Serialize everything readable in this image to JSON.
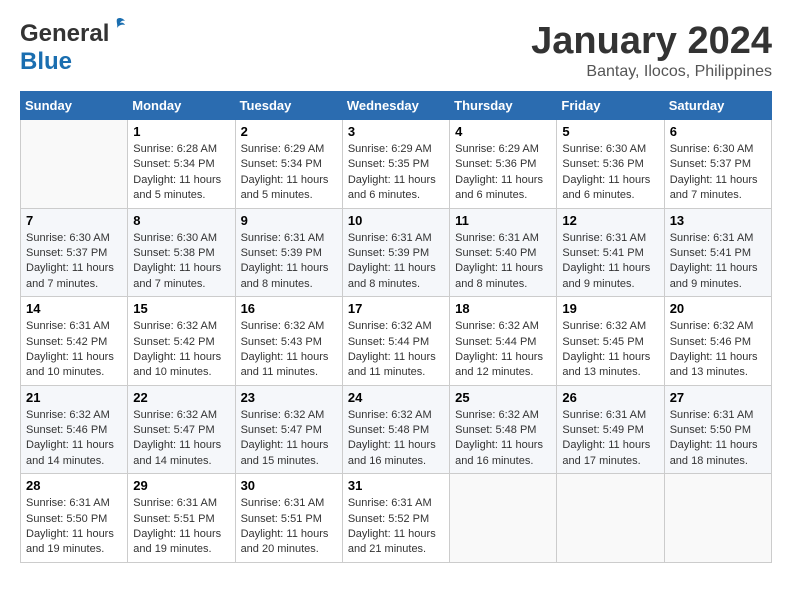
{
  "header": {
    "logo_line1": "General",
    "logo_line2": "Blue",
    "month": "January 2024",
    "location": "Bantay, Ilocos, Philippines"
  },
  "weekdays": [
    "Sunday",
    "Monday",
    "Tuesday",
    "Wednesday",
    "Thursday",
    "Friday",
    "Saturday"
  ],
  "weeks": [
    [
      {
        "day": "",
        "details": ""
      },
      {
        "day": "1",
        "details": "Sunrise: 6:28 AM\nSunset: 5:34 PM\nDaylight: 11 hours\nand 5 minutes."
      },
      {
        "day": "2",
        "details": "Sunrise: 6:29 AM\nSunset: 5:34 PM\nDaylight: 11 hours\nand 5 minutes."
      },
      {
        "day": "3",
        "details": "Sunrise: 6:29 AM\nSunset: 5:35 PM\nDaylight: 11 hours\nand 6 minutes."
      },
      {
        "day": "4",
        "details": "Sunrise: 6:29 AM\nSunset: 5:36 PM\nDaylight: 11 hours\nand 6 minutes."
      },
      {
        "day": "5",
        "details": "Sunrise: 6:30 AM\nSunset: 5:36 PM\nDaylight: 11 hours\nand 6 minutes."
      },
      {
        "day": "6",
        "details": "Sunrise: 6:30 AM\nSunset: 5:37 PM\nDaylight: 11 hours\nand 7 minutes."
      }
    ],
    [
      {
        "day": "7",
        "details": "Sunrise: 6:30 AM\nSunset: 5:37 PM\nDaylight: 11 hours\nand 7 minutes."
      },
      {
        "day": "8",
        "details": "Sunrise: 6:30 AM\nSunset: 5:38 PM\nDaylight: 11 hours\nand 7 minutes."
      },
      {
        "day": "9",
        "details": "Sunrise: 6:31 AM\nSunset: 5:39 PM\nDaylight: 11 hours\nand 8 minutes."
      },
      {
        "day": "10",
        "details": "Sunrise: 6:31 AM\nSunset: 5:39 PM\nDaylight: 11 hours\nand 8 minutes."
      },
      {
        "day": "11",
        "details": "Sunrise: 6:31 AM\nSunset: 5:40 PM\nDaylight: 11 hours\nand 8 minutes."
      },
      {
        "day": "12",
        "details": "Sunrise: 6:31 AM\nSunset: 5:41 PM\nDaylight: 11 hours\nand 9 minutes."
      },
      {
        "day": "13",
        "details": "Sunrise: 6:31 AM\nSunset: 5:41 PM\nDaylight: 11 hours\nand 9 minutes."
      }
    ],
    [
      {
        "day": "14",
        "details": "Sunrise: 6:31 AM\nSunset: 5:42 PM\nDaylight: 11 hours\nand 10 minutes."
      },
      {
        "day": "15",
        "details": "Sunrise: 6:32 AM\nSunset: 5:42 PM\nDaylight: 11 hours\nand 10 minutes."
      },
      {
        "day": "16",
        "details": "Sunrise: 6:32 AM\nSunset: 5:43 PM\nDaylight: 11 hours\nand 11 minutes."
      },
      {
        "day": "17",
        "details": "Sunrise: 6:32 AM\nSunset: 5:44 PM\nDaylight: 11 hours\nand 11 minutes."
      },
      {
        "day": "18",
        "details": "Sunrise: 6:32 AM\nSunset: 5:44 PM\nDaylight: 11 hours\nand 12 minutes."
      },
      {
        "day": "19",
        "details": "Sunrise: 6:32 AM\nSunset: 5:45 PM\nDaylight: 11 hours\nand 13 minutes."
      },
      {
        "day": "20",
        "details": "Sunrise: 6:32 AM\nSunset: 5:46 PM\nDaylight: 11 hours\nand 13 minutes."
      }
    ],
    [
      {
        "day": "21",
        "details": "Sunrise: 6:32 AM\nSunset: 5:46 PM\nDaylight: 11 hours\nand 14 minutes."
      },
      {
        "day": "22",
        "details": "Sunrise: 6:32 AM\nSunset: 5:47 PM\nDaylight: 11 hours\nand 14 minutes."
      },
      {
        "day": "23",
        "details": "Sunrise: 6:32 AM\nSunset: 5:47 PM\nDaylight: 11 hours\nand 15 minutes."
      },
      {
        "day": "24",
        "details": "Sunrise: 6:32 AM\nSunset: 5:48 PM\nDaylight: 11 hours\nand 16 minutes."
      },
      {
        "day": "25",
        "details": "Sunrise: 6:32 AM\nSunset: 5:48 PM\nDaylight: 11 hours\nand 16 minutes."
      },
      {
        "day": "26",
        "details": "Sunrise: 6:31 AM\nSunset: 5:49 PM\nDaylight: 11 hours\nand 17 minutes."
      },
      {
        "day": "27",
        "details": "Sunrise: 6:31 AM\nSunset: 5:50 PM\nDaylight: 11 hours\nand 18 minutes."
      }
    ],
    [
      {
        "day": "28",
        "details": "Sunrise: 6:31 AM\nSunset: 5:50 PM\nDaylight: 11 hours\nand 19 minutes."
      },
      {
        "day": "29",
        "details": "Sunrise: 6:31 AM\nSunset: 5:51 PM\nDaylight: 11 hours\nand 19 minutes."
      },
      {
        "day": "30",
        "details": "Sunrise: 6:31 AM\nSunset: 5:51 PM\nDaylight: 11 hours\nand 20 minutes."
      },
      {
        "day": "31",
        "details": "Sunrise: 6:31 AM\nSunset: 5:52 PM\nDaylight: 11 hours\nand 21 minutes."
      },
      {
        "day": "",
        "details": ""
      },
      {
        "day": "",
        "details": ""
      },
      {
        "day": "",
        "details": ""
      }
    ]
  ]
}
